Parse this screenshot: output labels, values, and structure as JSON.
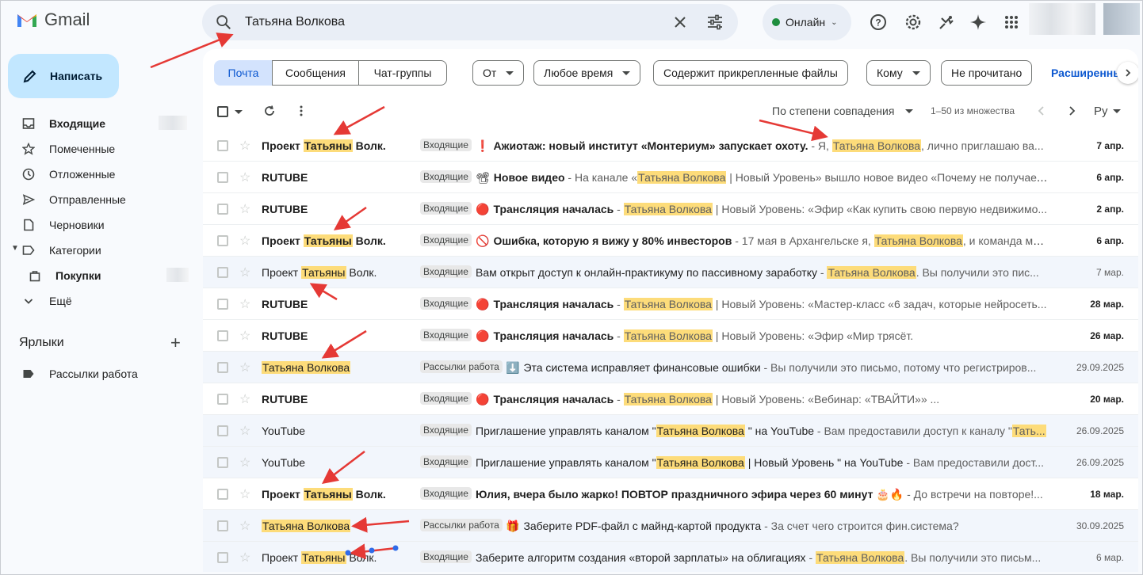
{
  "app": {
    "name": "Gmail"
  },
  "search": {
    "query": "Татьяна Волкова"
  },
  "status": {
    "label": "Онлайн"
  },
  "compose": {
    "label": "Написать"
  },
  "nav": [
    {
      "label": "Входящие",
      "icon": "inbox-icon",
      "bold": true
    },
    {
      "label": "Помеченные",
      "icon": "star-icon"
    },
    {
      "label": "Отложенные",
      "icon": "clock-icon"
    },
    {
      "label": "Отправленные",
      "icon": "send-icon"
    },
    {
      "label": "Черновики",
      "icon": "draft-icon"
    },
    {
      "label": "Категории",
      "icon": "label-outline-icon"
    },
    {
      "label": "Покупки",
      "icon": "shopping-bag-icon",
      "bold": true
    },
    {
      "label": "Ещё",
      "icon": "chevron-down-icon"
    }
  ],
  "labels": {
    "heading": "Ярлыки",
    "items": [
      "Рассылки работа"
    ]
  },
  "scope_tabs": [
    "Почта",
    "Сообщения",
    "Чат-группы"
  ],
  "filters": [
    "От",
    "Любое время",
    "Содержит прикрепленные файлы",
    "Кому",
    "Не прочитано"
  ],
  "advanced_label": "Расширенны",
  "toolbar": {
    "sort": "По степени совпадения",
    "range": "1–50 из множества",
    "lang": "Ру"
  },
  "emails": [
    {
      "unread": true,
      "sender_pre": "Проект ",
      "sender_hl": "Татьяны",
      "sender_post": " Волк.",
      "tag": "Входящие",
      "emoji": "❗",
      "subject": "Ажиотаж: новый институт «Монтериум» запускает охоту.",
      "snip_pre": " - Я, ",
      "snip_hl": "Татьяна Волкова",
      "snip_post": ", лично приглашаю ва...",
      "date": "7 апр."
    },
    {
      "unread": true,
      "sender_pre": "RUTUBE",
      "sender_hl": "",
      "sender_post": "",
      "tag": "Входящие",
      "emoji": "📽",
      "subject": "Новое видео",
      "snip_pre": " - На канале «",
      "snip_hl": "Татьяна Волкова",
      "snip_post": " | Новый Уровень» вышло новое видео «Почему не получает...",
      "date": "6 апр."
    },
    {
      "unread": true,
      "sender_pre": "RUTUBE",
      "sender_hl": "",
      "sender_post": "",
      "tag": "Входящие",
      "emoji": "🔴",
      "subject": "Трансляция началась",
      "snip_pre": " - ",
      "snip_hl": "Татьяна Волкова",
      "snip_post": " | Новый Уровень: «Эфир «Как купить свою первую недвижимо...",
      "date": "2 апр."
    },
    {
      "unread": true,
      "sender_pre": "Проект ",
      "sender_hl": "Татьяны",
      "sender_post": " Волк.",
      "tag": "Входящие",
      "emoji": "🚫",
      "subject": "Ошибка, которую я вижу у 80% инвесторов",
      "snip_pre": " - 17 мая в Архангельске я, ",
      "snip_hl": "Татьяна Волкова",
      "snip_post": ", и команда мо...",
      "date": "6 апр."
    },
    {
      "unread": false,
      "sender_pre": "Проект ",
      "sender_hl": "Татьяны",
      "sender_post": " Волк.",
      "tag": "Входящие",
      "emoji": "",
      "subject": "Вам открыт доступ к онлайн-практикуму по пассивному заработку",
      "snip_pre": " - ",
      "snip_hl": "Татьяна Волкова",
      "snip_post": ". Вы получили это пис...",
      "date": "7 мар."
    },
    {
      "unread": true,
      "sender_pre": "RUTUBE",
      "sender_hl": "",
      "sender_post": "",
      "tag": "Входящие",
      "emoji": "🔴",
      "subject": "Трансляция началась",
      "snip_pre": " - ",
      "snip_hl": "Татьяна Волкова",
      "snip_post": " | Новый Уровень: «Мастер-класс «6 задач, которые нейросеть...",
      "date": "28 мар."
    },
    {
      "unread": true,
      "sender_pre": "RUTUBE",
      "sender_hl": "",
      "sender_post": "",
      "tag": "Входящие",
      "emoji": "🔴",
      "subject": "Трансляция началась",
      "snip_pre": " - ",
      "snip_hl": "Татьяна Волкова",
      "snip_post": " | Новый Уровень: «Эфир «Мир трясёт.",
      "date": "26 мар."
    },
    {
      "unread": false,
      "sender_pre": "",
      "sender_hl": "Татьяна Волкова",
      "sender_post": "",
      "tag": "Рассылки работа",
      "emoji": "⬇️",
      "subject": "Эта система исправляет финансовые ошибки",
      "snip_pre": " - Вы получили это письмо, потому что регистриров...",
      "snip_hl": "",
      "snip_post": "",
      "date": "29.09.2025"
    },
    {
      "unread": true,
      "sender_pre": "RUTUBE",
      "sender_hl": "",
      "sender_post": "",
      "tag": "Входящие",
      "emoji": "🔴",
      "subject": "Трансляция началась",
      "snip_pre": " - ",
      "snip_hl": "Татьяна Волкова",
      "snip_post": " | Новый Уровень: «Вебинар: «ТВАЙТИ»» ...",
      "date": "20 мар."
    },
    {
      "unread": false,
      "sender_pre": "YouTube",
      "sender_hl": "",
      "sender_post": "",
      "tag": "Входящие",
      "emoji": "",
      "subject": "Приглашение управлять каналом \"",
      "subject_hl": "Татьяна Волкова",
      "subject_post": " \" на YouTube",
      "snip_pre": " - Вам предоставили доступ к каналу \"",
      "snip_hl": "Тать...",
      "snip_post": "",
      "date": "26.09.2025"
    },
    {
      "unread": false,
      "sender_pre": "YouTube",
      "sender_hl": "",
      "sender_post": "",
      "tag": "Входящие",
      "emoji": "",
      "subject": "Приглашение управлять каналом \"",
      "subject_hl": "Татьяна Волкова",
      "subject_post": " | Новый Уровень \" на YouTube",
      "snip_pre": " - Вам предоставили дост...",
      "snip_hl": "",
      "snip_post": "",
      "date": "26.09.2025"
    },
    {
      "unread": true,
      "sender_pre": "Проект ",
      "sender_hl": "Татьяны",
      "sender_post": " Волк.",
      "tag": "Входящие",
      "emoji": "",
      "subject": "Юлия, вчера было жарко! ПОВТОР праздничного эфира через 60 минут 🎂🔥",
      "snip_pre": " - До встречи на повторе!...",
      "snip_hl": "",
      "snip_post": "",
      "date": "18 мар."
    },
    {
      "unread": false,
      "sender_pre": "",
      "sender_hl": "Татьяна Волкова",
      "sender_post": "",
      "tag": "Рассылки работа",
      "emoji": "🎁",
      "subject": "Заберите PDF-файл с майнд-картой продукта",
      "snip_pre": " - За счет чего строится фин.система?",
      "snip_hl": "",
      "snip_post": "",
      "date": "30.09.2025"
    },
    {
      "unread": false,
      "sender_pre": "Проект ",
      "sender_hl": "Татьяны",
      "sender_post": " Волк.",
      "tag": "Входящие",
      "emoji": "",
      "subject": "Заберите алгоритм создания «второй зарплаты» на облигациях",
      "snip_pre": " - ",
      "snip_hl": "Татьяна Волкова",
      "snip_post": ". Вы получили это письм...",
      "date": "6 мар."
    }
  ],
  "colors": {
    "highlight": "#fddc7a",
    "compose_bg": "#c2e7ff",
    "active_tab": "#d3e3fd",
    "annotation_arrow": "#e53935"
  }
}
